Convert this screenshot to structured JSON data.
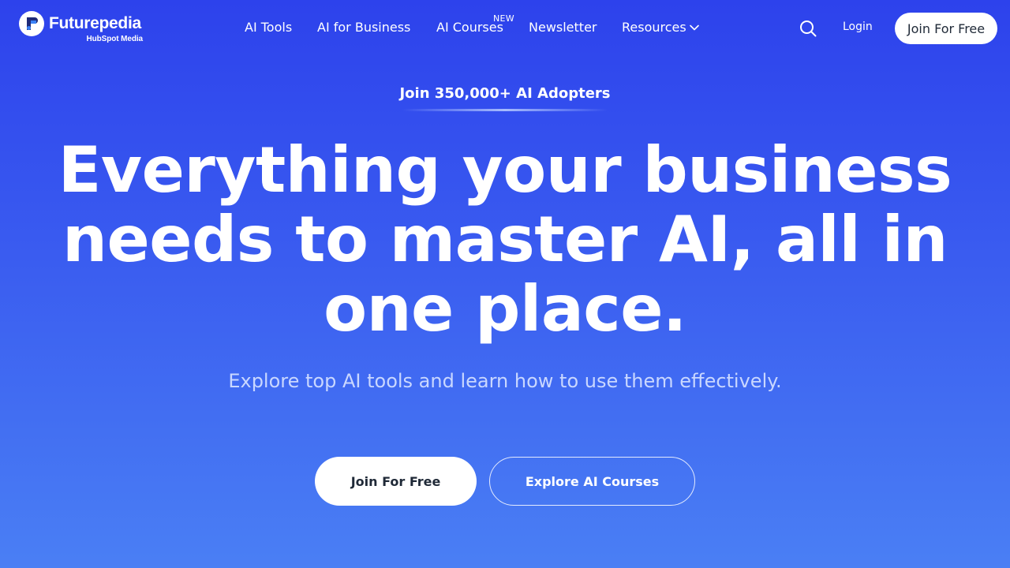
{
  "header": {
    "logo": {
      "name": "Futurepedia",
      "subtitle": "HubSpot Media",
      "icon": "futurepedia-logo-icon"
    },
    "nav": {
      "items": [
        {
          "label": "AI Tools"
        },
        {
          "label": "AI for Business"
        },
        {
          "label": "AI Courses",
          "badge": "NEW"
        },
        {
          "label": "Newsletter"
        },
        {
          "label": "Resources",
          "icon": "chevron-down-icon"
        }
      ]
    },
    "search_icon": "search-icon",
    "login_label": "Login",
    "join_label": "Join For Free"
  },
  "hero": {
    "eyebrow": "Join 350,000+ AI Adopters",
    "headline": "Everything your business needs to master AI, all in one place.",
    "subheadline": "Explore top AI tools and learn how to use them effectively.",
    "primary_cta": "Join For Free",
    "secondary_cta": "Explore AI Courses"
  },
  "colors": {
    "background_top": "#2d42ec",
    "background_bottom": "#4a7ff4",
    "subheadline": "#c9d7ff",
    "button_text_dark": "#1f2937"
  }
}
